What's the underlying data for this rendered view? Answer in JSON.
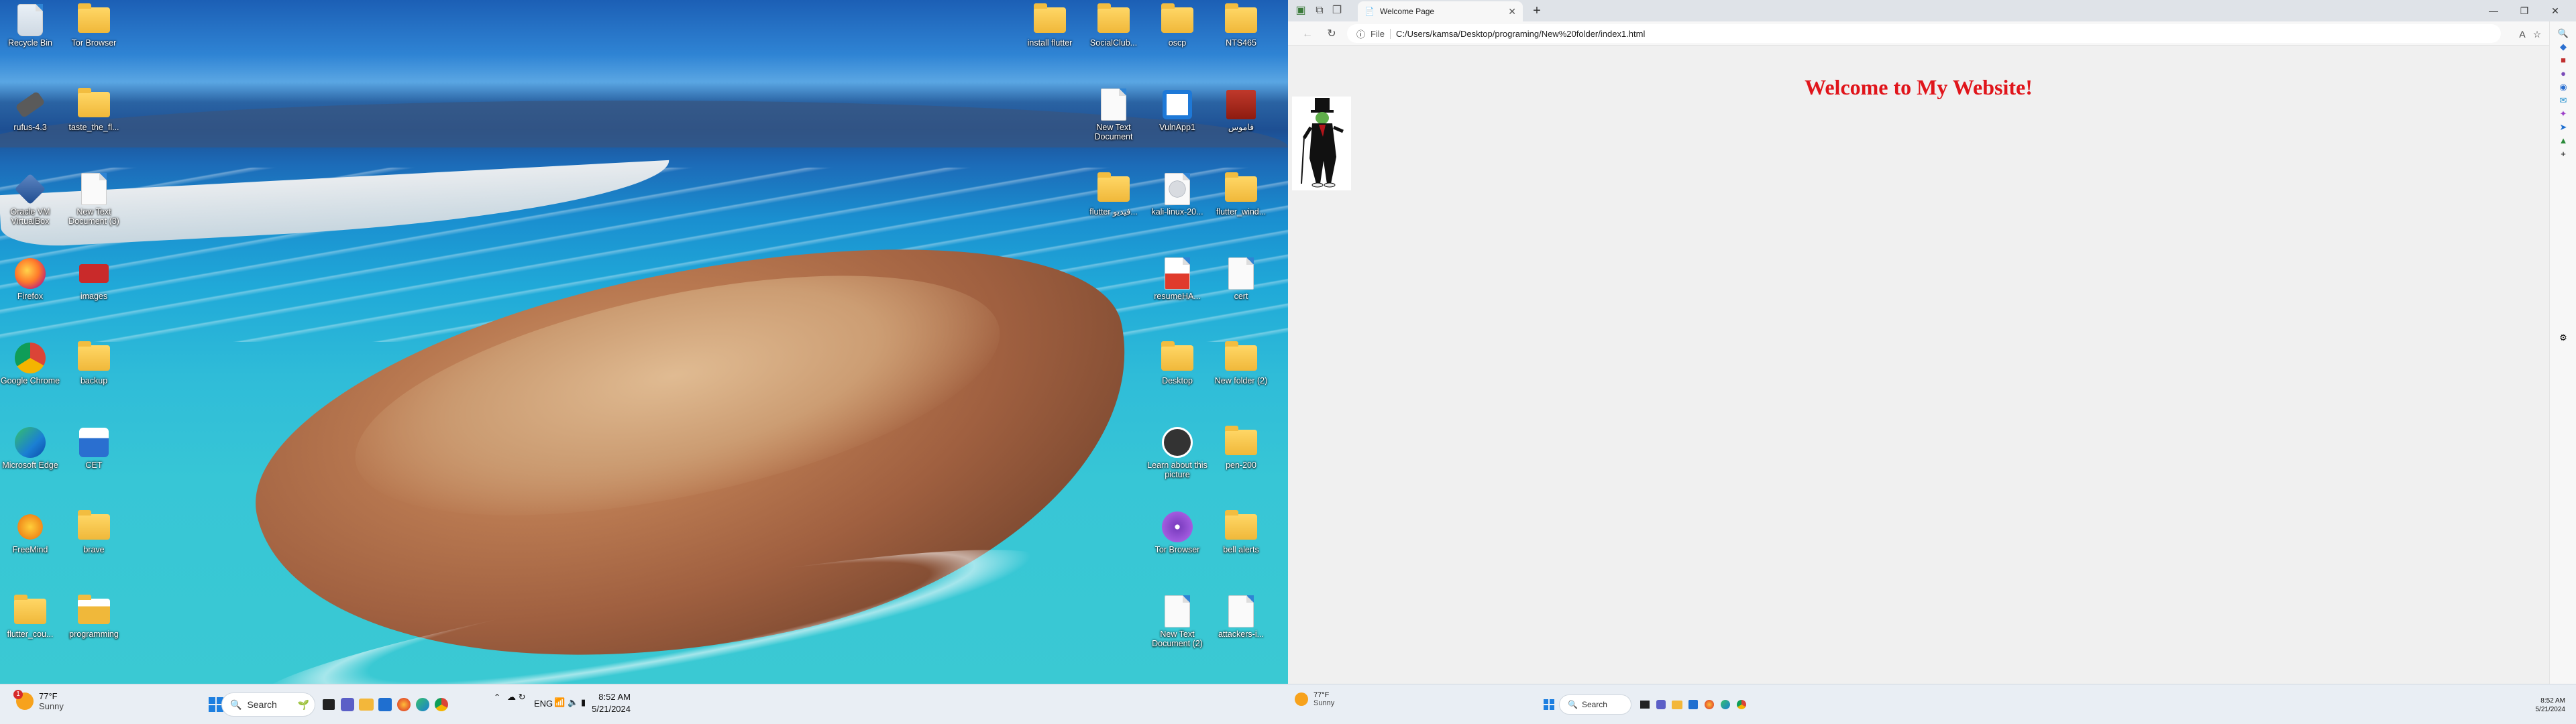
{
  "desktop": {
    "left_icons": [
      {
        "label": "Recycle Bin",
        "icon": "recycle-bin-icon"
      },
      {
        "label": "Tor Browser",
        "icon": "folder-icon"
      },
      {
        "label": "rufus-4.3",
        "icon": "usb-icon"
      },
      {
        "label": "taste_the_fl...",
        "icon": "folder-icon"
      },
      {
        "label": "Oracle VM VirtualBox",
        "icon": "virtualbox-icon"
      },
      {
        "label": "New Text Document (3)",
        "icon": "document-icon"
      },
      {
        "label": "Firefox",
        "icon": "firefox-icon"
      },
      {
        "label": "images",
        "icon": "truck-icon"
      },
      {
        "label": "Google Chrome",
        "icon": "chrome-icon"
      },
      {
        "label": "backup",
        "icon": "folder-icon"
      },
      {
        "label": "Microsoft Edge",
        "icon": "edge-icon"
      },
      {
        "label": "CET",
        "icon": "app-icon"
      },
      {
        "label": "FreeMind",
        "icon": "butterfly-icon"
      },
      {
        "label": "brave",
        "icon": "folder-icon"
      },
      {
        "label": "flutter_cou...",
        "icon": "folder-icon"
      },
      {
        "label": "programming",
        "icon": "folder-app-icon"
      }
    ],
    "right_icons": [
      {
        "label": "install flutter",
        "icon": "folder-icon"
      },
      {
        "label": "SocialClub...",
        "icon": "folder-icon"
      },
      {
        "label": "oscp",
        "icon": "folder-icon"
      },
      {
        "label": "NTS465",
        "icon": "folder-icon"
      },
      {
        "label": "New Text Document",
        "icon": "document-icon"
      },
      {
        "label": "VulnApp1",
        "icon": "app-window-icon"
      },
      {
        "label": "قاموس",
        "icon": "dictionary-icon"
      },
      {
        "label": "flutter فيديو...",
        "icon": "folder-icon"
      },
      {
        "label": "kali-linux-20...",
        "icon": "disc-icon"
      },
      {
        "label": "flutter_wind...",
        "icon": "folder-icon"
      },
      {
        "label": "resumeHA...",
        "icon": "pdf-icon"
      },
      {
        "label": "cert",
        "icon": "document-icon"
      },
      {
        "label": "Desktop",
        "icon": "folder-icon"
      },
      {
        "label": "New folder (2)",
        "icon": "folder-icon"
      },
      {
        "label": "Learn about this picture",
        "icon": "camera-icon"
      },
      {
        "label": "pen-200",
        "icon": "folder-icon"
      },
      {
        "label": "Tor Browser",
        "icon": "tor-icon"
      },
      {
        "label": "bell alerts",
        "icon": "folder-icon"
      },
      {
        "label": "New Text Document (2)",
        "icon": "document-icon"
      },
      {
        "label": "attackers-i...",
        "icon": "document-icon"
      }
    ]
  },
  "taskbar": {
    "weather_temp": "77°F",
    "weather_desc": "Sunny",
    "weather_badge": "1",
    "search_placeholder": "Search",
    "language": "ENG",
    "time": "8:52 AM",
    "date": "5/21/2024"
  },
  "browser": {
    "tab_title": "Welcome Page",
    "url_prefix": "File",
    "url": "C:/Users/kamsa/Desktop/programing/New%20folder/index1.html",
    "page_heading": "Welcome to My Website!"
  },
  "colors": {
    "heading": "#e0151b",
    "taskbar": "#e9eef4"
  }
}
